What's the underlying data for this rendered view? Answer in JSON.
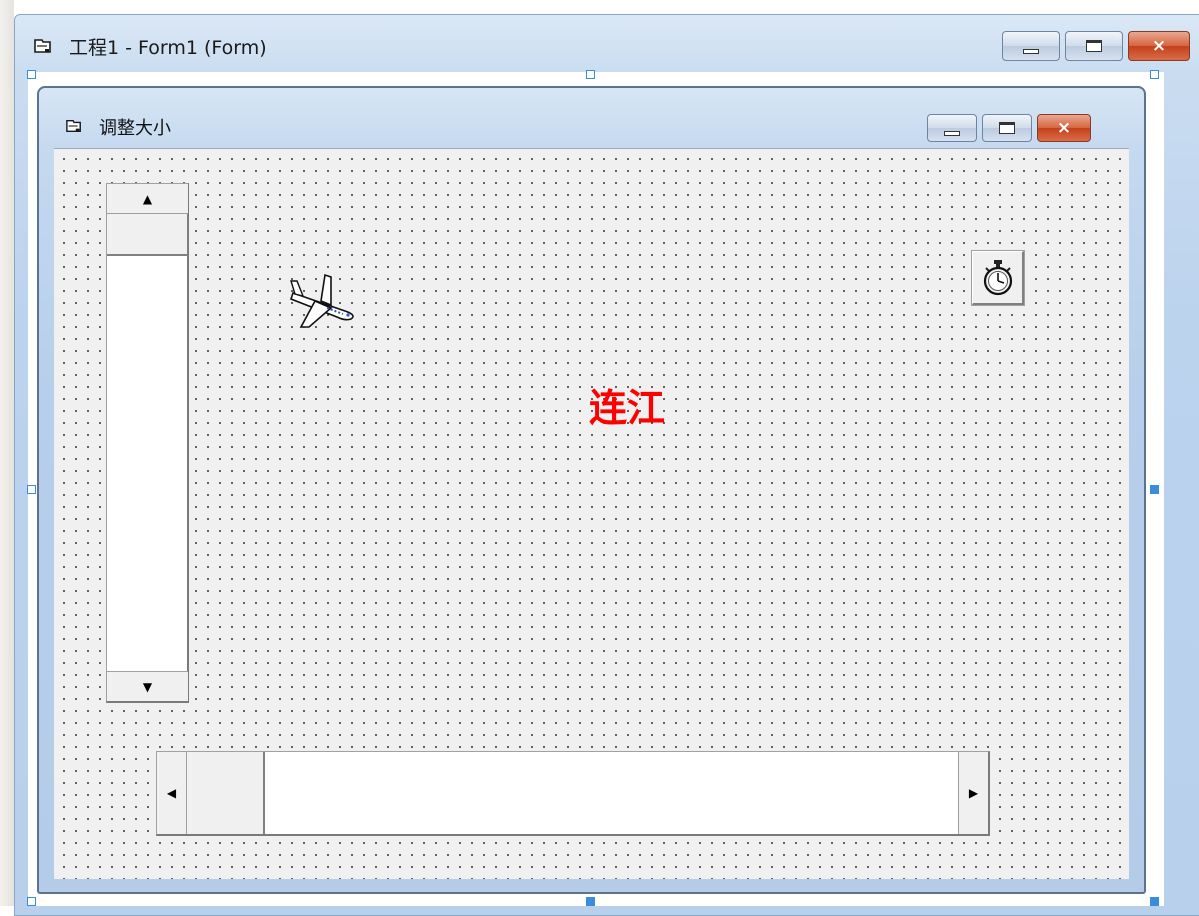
{
  "designer": {
    "title": "工程1 - Form1 (Form)",
    "icon": "form-icon"
  },
  "form": {
    "caption": "调整大小",
    "icon": "form-icon"
  },
  "caption_buttons": {
    "minimize": "minimize-icon",
    "maximize": "maximize-icon",
    "close_symbol": "×"
  },
  "controls": {
    "label_caption": "连江",
    "label_color": "#ff0000",
    "vscroll": {
      "up_arrow": "▲",
      "down_arrow": "▼"
    },
    "hscroll": {
      "left_arrow": "◀",
      "right_arrow": "▶"
    },
    "image_icon": "airplane-icon",
    "timer_icon": "stopwatch-icon"
  },
  "colors": {
    "selection_handle": "#3c8cdc",
    "title_bar": "#c9dcf0",
    "close_button": "#c4401b"
  }
}
